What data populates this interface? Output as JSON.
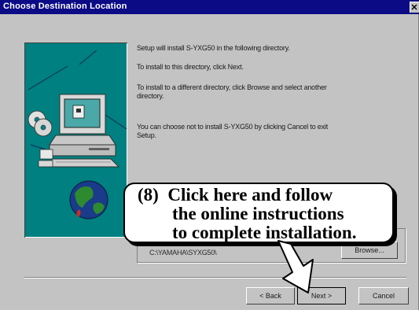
{
  "window": {
    "title": "Choose Destination Location"
  },
  "body_text": {
    "line1": "Setup will install S-YXG50 in the following directory.",
    "line2": "To install to this directory, click Next.",
    "line3a": "To install to a different directory, click Browse and select another",
    "line3b": "directory.",
    "line4a": "You can choose not to install S-YXG50 by clicking Cancel to exit",
    "line4b": "Setup."
  },
  "destination": {
    "path": "C:\\YAMAHA\\SYXG50\\",
    "browse_label": "Browse..."
  },
  "buttons": {
    "back_label": "< Back",
    "next_label": "Next >",
    "cancel_label": "Cancel"
  },
  "callout": {
    "number": "(8)",
    "line1": "Click here and follow",
    "line2": "the online instructions",
    "line3": "to complete installation."
  },
  "icons": [
    "close-icon",
    "computer-icon",
    "cd-disc-icon",
    "globe-icon"
  ],
  "colors": {
    "titlebar": "#0b0b86",
    "dialog": "#c3c3c3",
    "art_background": "#008080"
  }
}
